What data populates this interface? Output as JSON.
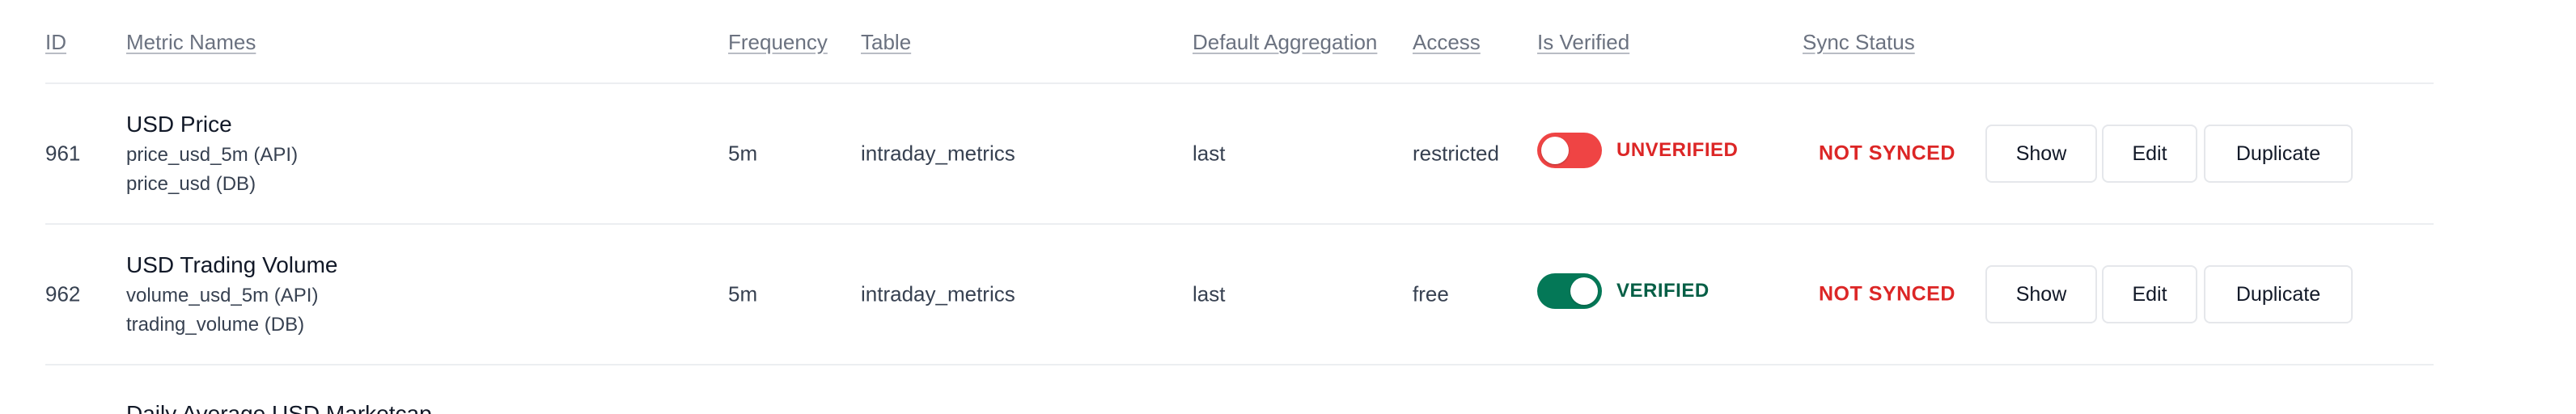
{
  "colors": {
    "unverified": "#ef4444",
    "unverified_text": "#dc2626",
    "verified": "#047857",
    "verified_text": "#065f46",
    "not_synced_text": "#dc2626"
  },
  "headers": {
    "id": "ID",
    "metric_names": "Metric Names",
    "frequency": "Frequency",
    "table": "Table",
    "default_aggregation": "Default Aggregation",
    "access": "Access",
    "is_verified": "Is Verified",
    "sync_status": "Sync Status"
  },
  "rows": [
    {
      "id": "961",
      "name": "USD Price",
      "api_name": "price_usd_5m (API)",
      "db_name": "price_usd (DB)",
      "frequency": "5m",
      "table": "intraday_metrics",
      "aggregation": "last",
      "access": "restricted",
      "verified": false,
      "verified_label": "UNVERIFIED",
      "sync_status": "NOT SYNCED",
      "actions": {
        "show": "Show",
        "edit": "Edit",
        "duplicate": "Duplicate"
      }
    },
    {
      "id": "962",
      "name": "USD Trading Volume",
      "api_name": "volume_usd_5m (API)",
      "db_name": "trading_volume (DB)",
      "frequency": "5m",
      "table": "intraday_metrics",
      "aggregation": "last",
      "access": "free",
      "verified": true,
      "verified_label": "VERIFIED",
      "sync_status": "NOT SYNCED",
      "actions": {
        "show": "Show",
        "edit": "Edit",
        "duplicate": "Duplicate"
      }
    }
  ],
  "partial_row": {
    "name": "Daily Average USD Marketcap"
  }
}
